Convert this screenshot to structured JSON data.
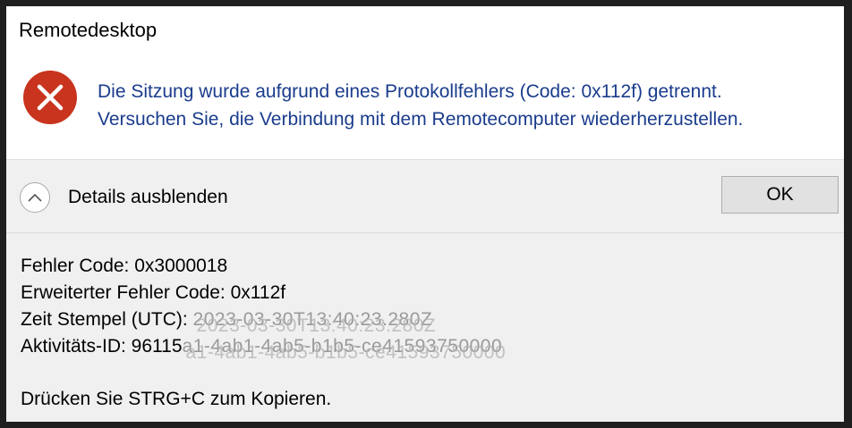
{
  "dialog": {
    "title": "Remotedesktop",
    "icon": "error-icon",
    "message_line1": "Die Sitzung wurde aufgrund eines Protokollfehlers (Code: 0x112f) getrennt.",
    "message_line2": "Versuchen Sie, die Verbindung mit dem Remotecomputer wiederherzustellen."
  },
  "details_toggle": {
    "icon": "chevron-up-icon",
    "label": "Details ausblenden"
  },
  "ok_button": {
    "label": "OK"
  },
  "details": {
    "error_code": "Fehler Code: 0x3000018",
    "extended_error_code": "Erweiterter Fehler Code: 0x112f",
    "timestamp_label": "Zeit Stempel (UTC):",
    "timestamp_value": "2023-03-30T13:40:23.280Z",
    "activity_label": "Aktivitäts-ID: 96115",
    "activity_value": "a1-4ab1-4ab5-b1b5-ce41593750000"
  },
  "copy_hint": "Drücken Sie STRG+C zum Kopieren.",
  "colors": {
    "error_red": "#c8341e",
    "message_blue": "#1a3c8c",
    "panel_bg": "#f0f0f0"
  }
}
